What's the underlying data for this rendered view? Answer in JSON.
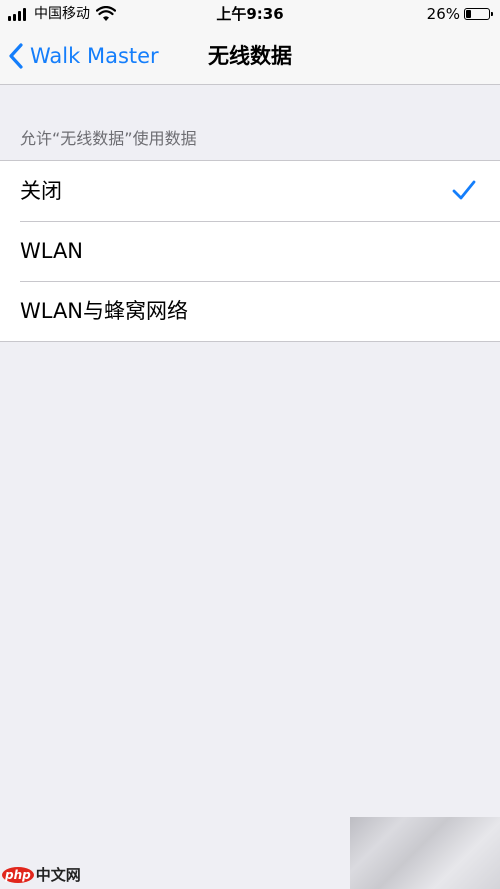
{
  "status_bar": {
    "carrier": "中国移动",
    "time": "上午9:36",
    "battery_percent": "26%",
    "battery_level": 0.26
  },
  "nav": {
    "back_label": "Walk Master",
    "title": "无线数据"
  },
  "section": {
    "header": "允许“无线数据”使用数据"
  },
  "options": [
    {
      "label": "关闭",
      "selected": true
    },
    {
      "label": "WLAN",
      "selected": false
    },
    {
      "label": "WLAN与蜂窝网络",
      "selected": false
    }
  ],
  "watermark": {
    "logo": "php",
    "text": "中文网"
  },
  "colors": {
    "accent": "#147efb",
    "background": "#efeff4",
    "separator": "#c8c7cc"
  },
  "icons": {
    "back": "chevron-left-icon",
    "check": "checkmark-icon",
    "wifi": "wifi-icon",
    "signal": "cellular-signal-icon",
    "battery": "battery-icon"
  }
}
